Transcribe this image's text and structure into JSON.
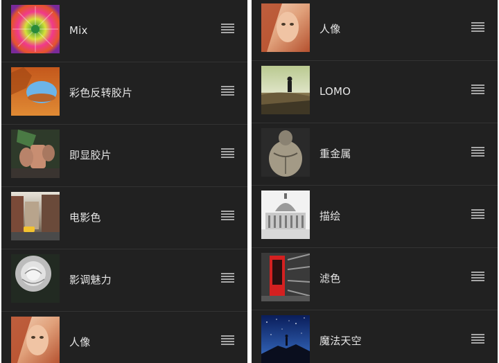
{
  "left_list": {
    "items": [
      {
        "label": "Mix",
        "thumb_icon": "colorful-flower-thumbnail"
      },
      {
        "label": "彩色反转胶片",
        "thumb_icon": "desert-arch-thumbnail"
      },
      {
        "label": "即显胶片",
        "thumb_icon": "hands-holding-cup-thumbnail"
      },
      {
        "label": "电影色",
        "thumb_icon": "city-street-taxi-thumbnail"
      },
      {
        "label": "影调魅力",
        "thumb_icon": "monochrome-rose-thumbnail"
      },
      {
        "label": "人像",
        "thumb_icon": "portrait-woman-thumbnail"
      }
    ]
  },
  "right_list": {
    "items": [
      {
        "label": "人像",
        "thumb_icon": "portrait-woman-thumbnail"
      },
      {
        "label": "LOMO",
        "thumb_icon": "person-on-hill-thumbnail"
      },
      {
        "label": "重金属",
        "thumb_icon": "muscular-torso-thumbnail"
      },
      {
        "label": "描绘",
        "thumb_icon": "capitol-building-sketch-thumbnail"
      },
      {
        "label": "滤色",
        "thumb_icon": "red-phone-booth-thumbnail"
      },
      {
        "label": "魔法天空",
        "thumb_icon": "starry-sky-silhouette-thumbnail"
      }
    ]
  },
  "colors": {
    "panel_background": "#212121",
    "divider": "#333333",
    "label_text": "#e6e6e6",
    "drag_handle": "#a8a8a8"
  },
  "drag_handle_icon": "drag-handle-icon"
}
